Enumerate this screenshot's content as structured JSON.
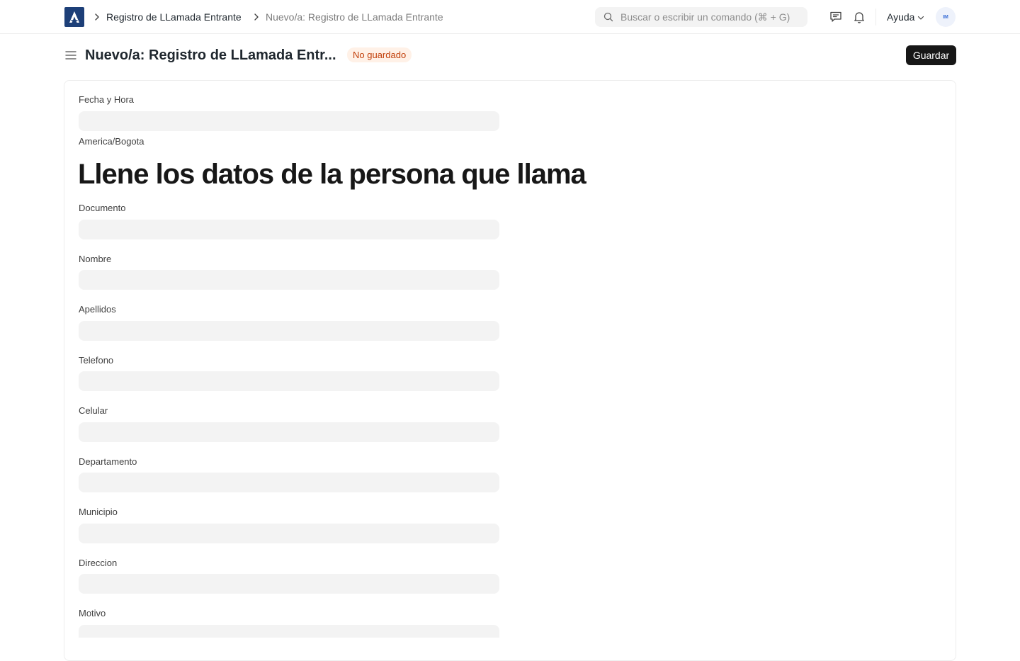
{
  "navbar": {
    "breadcrumbs": [
      "Registro de LLamada Entrante",
      "Nuevo/a: Registro de LLamada Entrante"
    ],
    "search_placeholder": "Buscar o escribir un comando (⌘ + G)",
    "help_label": "Ayuda",
    "avatar_initials": "IM",
    "icons": [
      "app-logo",
      "chevron-right-icon",
      "search-icon",
      "chat-icon",
      "bell-icon",
      "chevron-down-icon"
    ]
  },
  "page": {
    "title": "Nuevo/a: Registro de LLamada Entr...",
    "status_badge": "No guardado",
    "save_label": "Guardar"
  },
  "form": {
    "datetime_label": "Fecha y Hora",
    "timezone": "America/Bogota",
    "heading": "Llene los datos de la persona que llama",
    "fields": [
      {
        "label": "Documento",
        "value": ""
      },
      {
        "label": "Nombre",
        "value": ""
      },
      {
        "label": "Apellidos",
        "value": ""
      },
      {
        "label": "Telefono",
        "value": ""
      },
      {
        "label": "Celular",
        "value": ""
      },
      {
        "label": "Departamento",
        "value": ""
      },
      {
        "label": "Municipio",
        "value": ""
      },
      {
        "label": "Direccion",
        "value": ""
      },
      {
        "label": "Motivo",
        "value": ""
      }
    ]
  },
  "colors": {
    "brand": "#1d3f78",
    "primary_button": "#171717",
    "badge_bg": "#fff1e7",
    "badge_text": "#c2410c",
    "input_bg": "#f3f3f3"
  }
}
